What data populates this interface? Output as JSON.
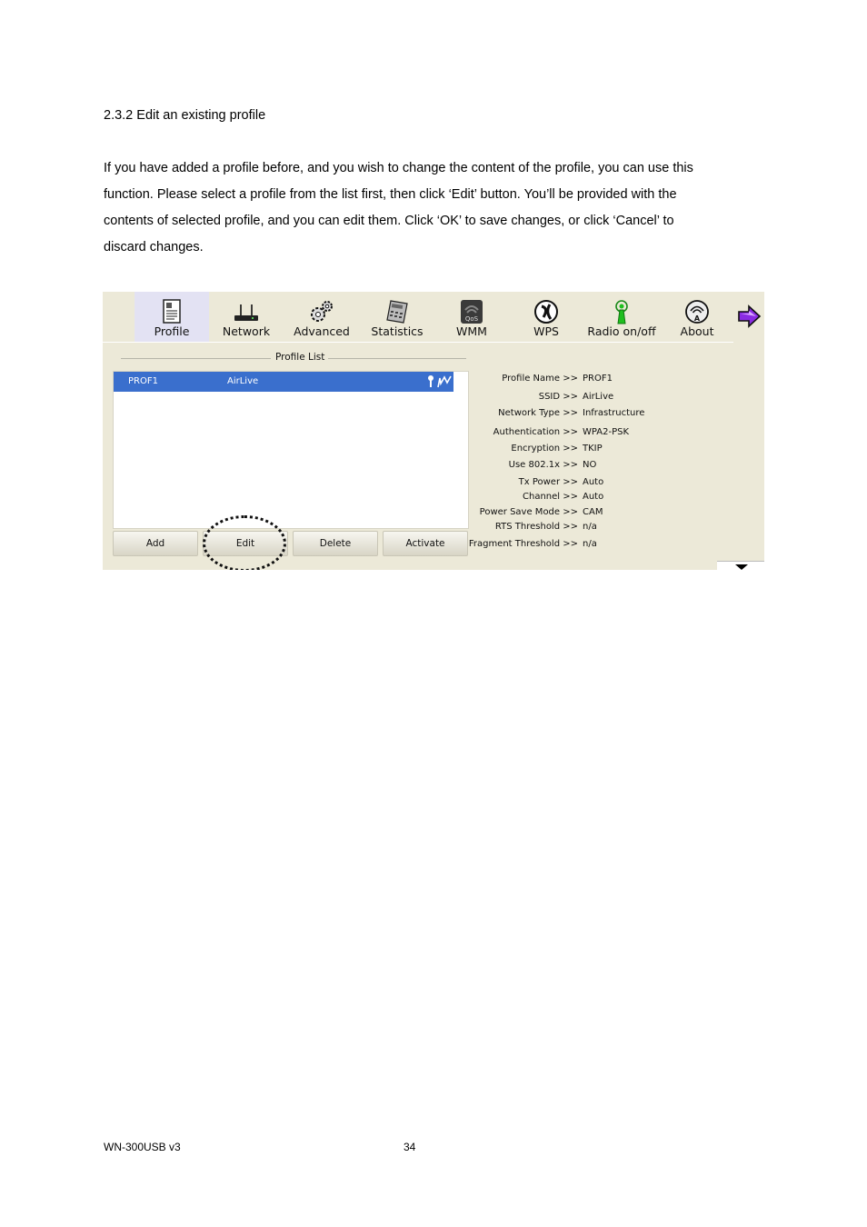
{
  "doc": {
    "heading": "2.3.2 Edit an existing profile",
    "paragraph_lines": [
      "If you have added a profile before, and you wish to change the content of the profile, you can use this",
      "function. Please select a profile from the list first, then click ‘Edit’ button. You’ll be provided with the",
      "contents of selected profile, and you can edit them. Click ‘OK’ to save changes, or click ‘Cancel’ to",
      "discard changes."
    ],
    "footer_left": "WN-300USB v3",
    "page_number": "34"
  },
  "toolbar": {
    "items": [
      {
        "label": "Profile",
        "icon": "profile-icon",
        "active": true
      },
      {
        "label": "Network",
        "icon": "network-icon"
      },
      {
        "label": "Advanced",
        "icon": "advanced-icon"
      },
      {
        "label": "Statistics",
        "icon": "statistics-icon"
      },
      {
        "label": "WMM",
        "icon": "wmm-icon"
      },
      {
        "label": "WPS",
        "icon": "wps-icon"
      },
      {
        "label": "Radio on/off",
        "icon": "radio-icon"
      },
      {
        "label": "About",
        "icon": "about-icon"
      }
    ]
  },
  "profile_list": {
    "legend": "Profile List",
    "rows": [
      {
        "name": "PROF1",
        "ssid": "AirLive",
        "selected": true
      }
    ],
    "buttons": {
      "add": "Add",
      "edit": "Edit",
      "delete": "Delete",
      "activate": "Activate"
    }
  },
  "details": [
    {
      "key": "Profile Name >>",
      "value": "PROF1"
    },
    {
      "key": "SSID >>",
      "value": "AirLive"
    },
    {
      "key": "Network Type >>",
      "value": "Infrastructure"
    },
    {
      "key": "Authentication >>",
      "value": "WPA2-PSK"
    },
    {
      "key": "Encryption >>",
      "value": "TKIP"
    },
    {
      "key": "Use 802.1x >>",
      "value": "NO"
    },
    {
      "key": "Tx Power >>",
      "value": "Auto"
    },
    {
      "key": "Channel >>",
      "value": "Auto"
    },
    {
      "key": "Power Save Mode >>",
      "value": "CAM"
    },
    {
      "key": "RTS Threshold >>",
      "value": "n/a"
    },
    {
      "key": "Fragment Threshold >>",
      "value": "n/a"
    }
  ],
  "colors": {
    "selection": "#3a6fcd",
    "panel": "#ece9d8",
    "active_tab": "#e3e2f3"
  }
}
